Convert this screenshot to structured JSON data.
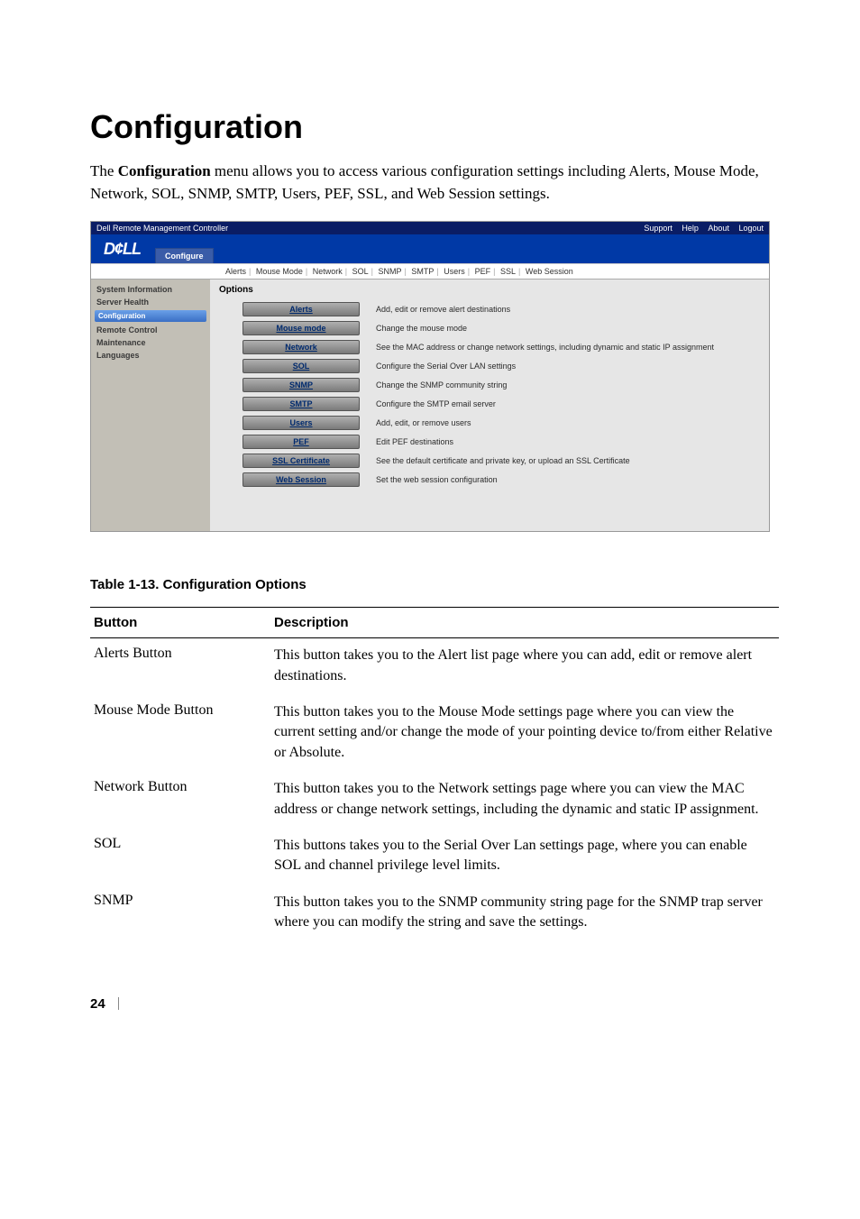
{
  "heading": "Configuration",
  "intro_prefix": "The ",
  "intro_bold": "Configuration",
  "intro_rest": " menu allows you to access various configuration settings including Alerts, Mouse Mode, Network, SOL, SNMP, SMTP, Users, PEF, SSL, and Web Session settings.",
  "screenshot": {
    "title": "Dell Remote Management Controller",
    "header_links": [
      "Support",
      "Help",
      "About",
      "Logout"
    ],
    "logo": "D¢LL",
    "main_tab": "Configure",
    "subtabs": [
      "Alerts",
      "Mouse Mode",
      "Network",
      "SOL",
      "SNMP",
      "SMTP",
      "Users",
      "PEF",
      "SSL",
      "Web Session"
    ],
    "sidebar": {
      "items": [
        "System Information",
        "Server Health",
        "Configuration",
        "Remote Control",
        "Maintenance",
        "Languages"
      ],
      "selected_index": 2
    },
    "options_label": "Options",
    "options": [
      {
        "label": "Alerts",
        "desc": "Add, edit or remove alert destinations"
      },
      {
        "label": "Mouse mode",
        "desc": "Change the mouse mode"
      },
      {
        "label": "Network",
        "desc": "See the MAC address or change network settings, including dynamic and static IP assignment"
      },
      {
        "label": "SOL",
        "desc": "Configure the Serial Over LAN settings"
      },
      {
        "label": "SNMP",
        "desc": "Change the SNMP community string"
      },
      {
        "label": "SMTP",
        "desc": "Configure the SMTP email server"
      },
      {
        "label": "Users",
        "desc": "Add, edit, or remove users"
      },
      {
        "label": "PEF",
        "desc": "Edit PEF destinations"
      },
      {
        "label": "SSL Certificate",
        "desc": "See the default certificate and private key, or upload an SSL Certificate"
      },
      {
        "label": "Web Session",
        "desc": "Set the web session configuration"
      }
    ]
  },
  "table_caption": "Table 1-13.    Configuration Options",
  "table": {
    "head_button": "Button",
    "head_desc": "Description",
    "rows": [
      {
        "button": "Alerts Button",
        "desc": "This button takes you to the Alert list page where you can add, edit or remove alert destinations."
      },
      {
        "button": "Mouse Mode Button",
        "desc": "This button takes you to the Mouse Mode settings page where you can view the current setting and/or change the mode of your pointing device to/from either Relative or Absolute."
      },
      {
        "button": "Network Button",
        "desc": "This button takes you to the Network settings page where you can view the MAC address or change network settings, including the dynamic and static IP assignment."
      },
      {
        "button": "SOL",
        "desc": "This buttons takes you to the Serial Over Lan settings page, where you can enable SOL and channel privilege level limits."
      },
      {
        "button": "SNMP",
        "desc": "This button takes you to the SNMP community string page for the SNMP trap server where you can modify the string and save the settings."
      }
    ]
  },
  "page_number": "24"
}
